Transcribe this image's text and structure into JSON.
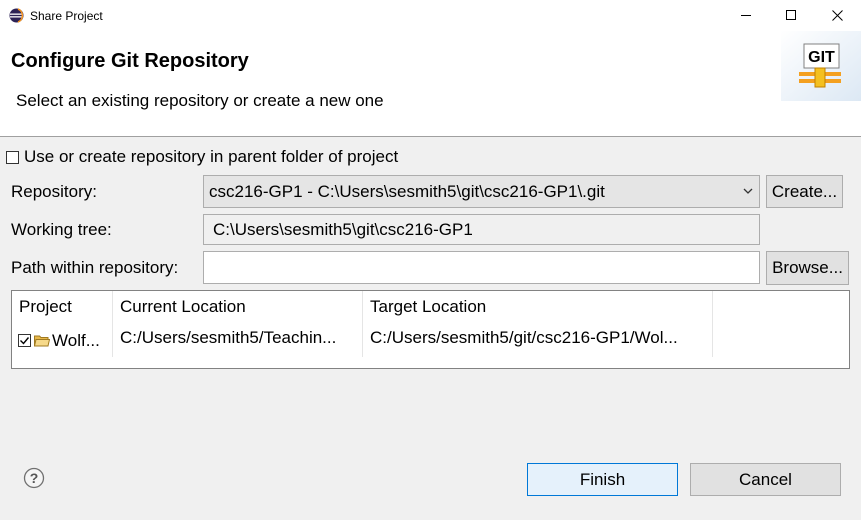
{
  "window": {
    "title": "Share Project"
  },
  "header": {
    "title": "Configure Git Repository",
    "subtitle": "Select an existing repository or create a new one",
    "logo_text": "GIT"
  },
  "form": {
    "parent_folder_checkbox": {
      "label": "Use or create repository in parent folder of project",
      "checked": false
    },
    "repository": {
      "label": "Repository:",
      "value": "csc216-GP1 - C:\\Users\\sesmith5\\git\\csc216-GP1\\.git",
      "create_button": "Create..."
    },
    "working_tree": {
      "label": "Working tree:",
      "value": "C:\\Users\\sesmith5\\git\\csc216-GP1"
    },
    "path_within_repository": {
      "label": "Path within repository:",
      "value": "",
      "browse_button": "Browse..."
    }
  },
  "table": {
    "columns": [
      "Project",
      "Current Location",
      "Target Location"
    ],
    "rows": [
      {
        "checked": true,
        "project": "Wolf...",
        "current_location": "C:/Users/sesmith5/Teachin...",
        "target_location": "C:/Users/sesmith5/git/csc216-GP1/Wol..."
      }
    ]
  },
  "footer": {
    "finish_button": "Finish",
    "cancel_button": "Cancel"
  },
  "colors": {
    "accent": "#0078d7",
    "git_logo_orange": "#f4a020",
    "folder_icon": "#e8b84a"
  },
  "icons": {
    "app": "eclipse-icon",
    "minimize": "minimize-icon",
    "maximize": "maximize-icon",
    "close": "close-icon",
    "logo": "git-logo",
    "combo": "chevron-down-icon",
    "project": "folder-icon",
    "help": "help-icon"
  }
}
